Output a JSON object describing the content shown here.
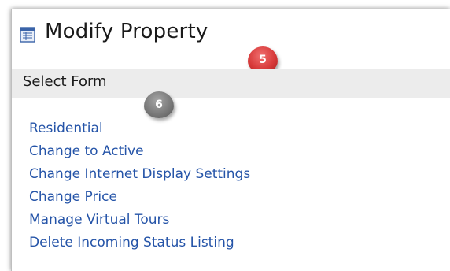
{
  "header": {
    "title": "Modify Property",
    "icon": "form-icon",
    "annotation_badge": "5"
  },
  "section": {
    "title": "Select Form",
    "annotation_badge": "6"
  },
  "links": [
    {
      "label": "Residential"
    },
    {
      "label": "Change to Active"
    },
    {
      "label": "Change Internet Display Settings"
    },
    {
      "label": "Change Price"
    },
    {
      "label": "Manage Virtual Tours"
    },
    {
      "label": "Delete Incoming Status Listing"
    }
  ],
  "colors": {
    "link": "#2554a8",
    "section_bg": "#ececec",
    "badge_red": "#d83a3a",
    "badge_gray": "#7a7a7a"
  }
}
